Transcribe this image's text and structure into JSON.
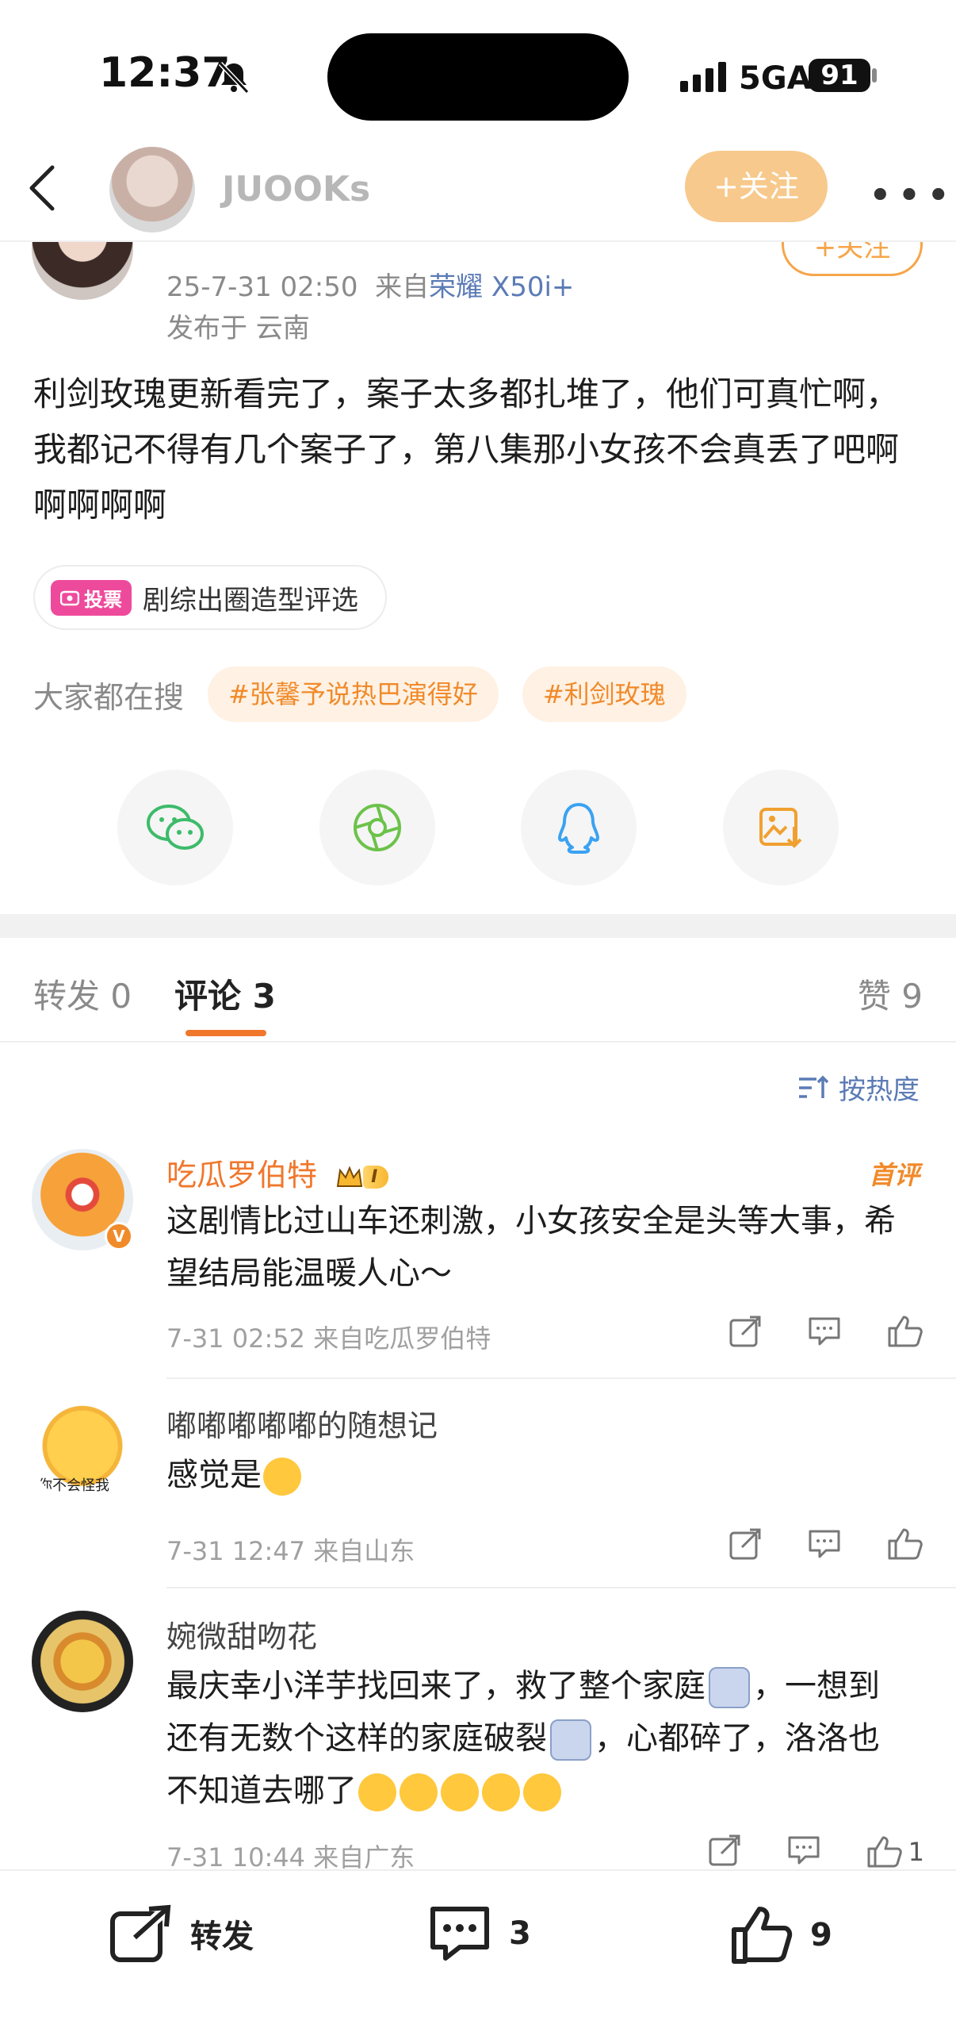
{
  "status_bar": {
    "time": "12:37",
    "network": "5GA",
    "battery": "91"
  },
  "header": {
    "username": "JUOOKs",
    "follow_label": "+关注",
    "more_label": "•••"
  },
  "post": {
    "follow_label": "+关注",
    "time": "25-7-31 02:50",
    "from_prefix": "来自",
    "device": "荣耀 X50i+",
    "location": "发布于 云南",
    "text": "利剑玫瑰更新看完了，案子太多都扎堆了，他们可真忙啊，我都记不得有几个案子了，第八集那小女孩不会真丢了吧啊啊啊啊啊",
    "vote_badge": "投票",
    "vote_label": "剧综出圈造型评选",
    "search_label": "大家都在搜",
    "tags": [
      "#张馨予说热巴演得好",
      "#利剑玫瑰"
    ]
  },
  "share_icons": [
    "wechat-icon",
    "moments-icon",
    "qq-icon",
    "save-image-icon"
  ],
  "tabs": {
    "repost": "转发 0",
    "comment": "评论 3",
    "like": "赞 9"
  },
  "sort_label": "按热度",
  "comments": [
    {
      "name": "吃瓜罗伯特",
      "vip_level": "I",
      "badge": "首评",
      "text": "这剧情比过山车还刺激，小女孩安全是头等大事，希望结局能温暖人心～",
      "meta": "7-31 02:52  来自吃瓜罗伯特",
      "like_count": ""
    },
    {
      "name": "嘟嘟嘟嘟嘟的随想记",
      "avatar_caption": "你不会怪我",
      "text": "感觉是",
      "meta": "7-31 12:47  来自山东",
      "like_count": ""
    },
    {
      "name": "婉微甜吻花",
      "text_1": "最庆幸小洋芋找回来了，救了整个家庭",
      "text_2": "，一想到还有无数个这样的家庭破裂",
      "text_3": "，心都碎了，洛洛也不知道去哪了",
      "meta": "7-31 10:44  来自广东",
      "like_count": "1"
    }
  ],
  "bottom_bar": {
    "repost": "转发",
    "comment_count": "3",
    "like_count": "9"
  },
  "colors": {
    "accent": "#f0772c",
    "link": "#5b7bb5",
    "tag_bg": "#fff1e3",
    "tag_text": "#f08a2a"
  }
}
